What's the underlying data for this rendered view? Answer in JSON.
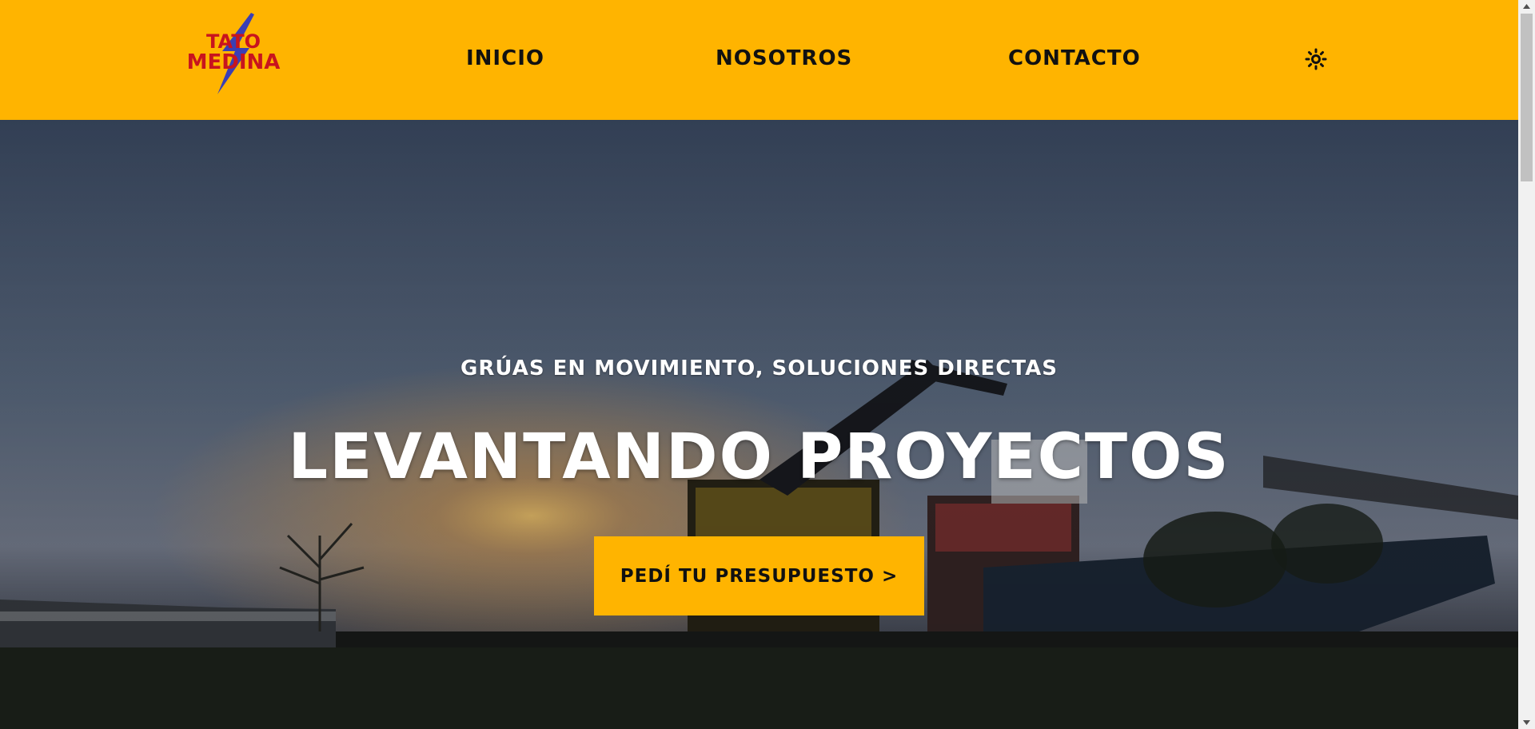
{
  "header": {
    "logo": {
      "line1": "TATO",
      "line2": "MEDINA",
      "icon": "lightning-bolt-logo"
    },
    "nav": {
      "inicio": "INICIO",
      "nosotros": "NOSOTROS",
      "contacto": "CONTACTO"
    },
    "theme_toggle_icon": "sun-icon"
  },
  "hero": {
    "subtitle": "GRÚAS EN MOVIMIENTO, SOLUCIONES DIRECTAS",
    "title": "LEVANTANDO PROYECTOS",
    "cta_label": "PEDÍ TU PRESUPUESTO >",
    "background": "crane-truck-sunset-photo"
  },
  "colors": {
    "accent": "#ffb400",
    "logo_text": "#c8141e",
    "logo_bolt": "#3a3fb5",
    "text_dark": "#111111",
    "text_light": "#ffffff"
  },
  "scrollbar": {
    "up_icon": "scroll-up-arrow-icon",
    "down_icon": "scroll-down-arrow-icon"
  }
}
